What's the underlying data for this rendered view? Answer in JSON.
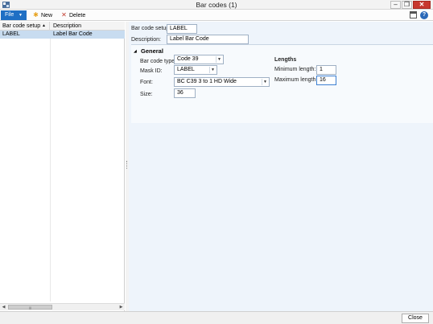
{
  "window": {
    "title": "Bar codes (1)",
    "controls": {
      "minimize": "–",
      "maximize": "❐",
      "close": "✕"
    }
  },
  "toolbar": {
    "file_label": "File",
    "new_label": "New",
    "delete_label": "Delete",
    "help_glyph": "?"
  },
  "grid": {
    "columns": [
      "Bar code setup",
      "Description"
    ],
    "rows": [
      {
        "setup": "LABEL",
        "description": "Label Bar Code",
        "selected": true
      }
    ]
  },
  "detail": {
    "bar_code_setup": {
      "label": "Bar code setup:",
      "value": "LABEL"
    },
    "description": {
      "label": "Description:",
      "value": "Label Bar Code"
    },
    "general": {
      "title": "General",
      "bar_code_type": {
        "label": "Bar code type:",
        "value": "Code 39"
      },
      "mask_id": {
        "label": "Mask ID:",
        "value": "LABEL"
      },
      "font": {
        "label": "Font:",
        "value": "BC C39 3 to 1 HD Wide"
      },
      "size": {
        "label": "Size:",
        "value": "36"
      },
      "lengths": {
        "title": "Lengths",
        "minimum": {
          "label": "Minimum length:",
          "value": "1"
        },
        "maximum": {
          "label": "Maximum length:",
          "value": "16"
        }
      }
    }
  },
  "footer": {
    "close_label": "Close"
  },
  "colors": {
    "accent": "#1f6fc4",
    "selected_row": "#c8dcf0",
    "detail_bg": "#eef4fb",
    "close_red": "#c7372e"
  }
}
